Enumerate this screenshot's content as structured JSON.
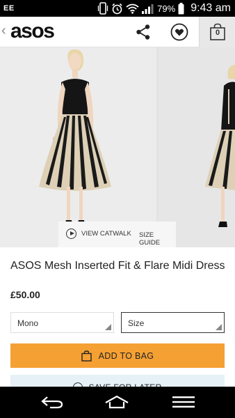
{
  "status_bar": {
    "carrier": "EE",
    "battery_percent": "79%",
    "time": "9:43 am",
    "icons": [
      "phone-vibrate-icon",
      "alarm-icon",
      "wifi-icon",
      "signal-icon",
      "battery-icon"
    ]
  },
  "header": {
    "logo": "asos",
    "back_icon": "‹",
    "bag_count": "0",
    "icons": [
      "share-icon",
      "heart-icon",
      "bag-icon"
    ]
  },
  "gallery": {
    "view_catwalk": "VIEW CATWALK",
    "size_guide": "SIZE GUIDE",
    "images": [
      "dress-front",
      "dress-back"
    ]
  },
  "product": {
    "title": "ASOS Mesh Inserted Fit & Flare Midi Dress",
    "price": "£50.00"
  },
  "options": {
    "colour": "Mono",
    "size_placeholder": "Size"
  },
  "actions": {
    "add_to_bag": "ADD TO BAG",
    "save_for_later": "SAVE FOR LATER"
  },
  "colors": {
    "accent_orange": "#f5a033",
    "save_bg": "#e5f1f7",
    "status_bar": "#000000"
  }
}
